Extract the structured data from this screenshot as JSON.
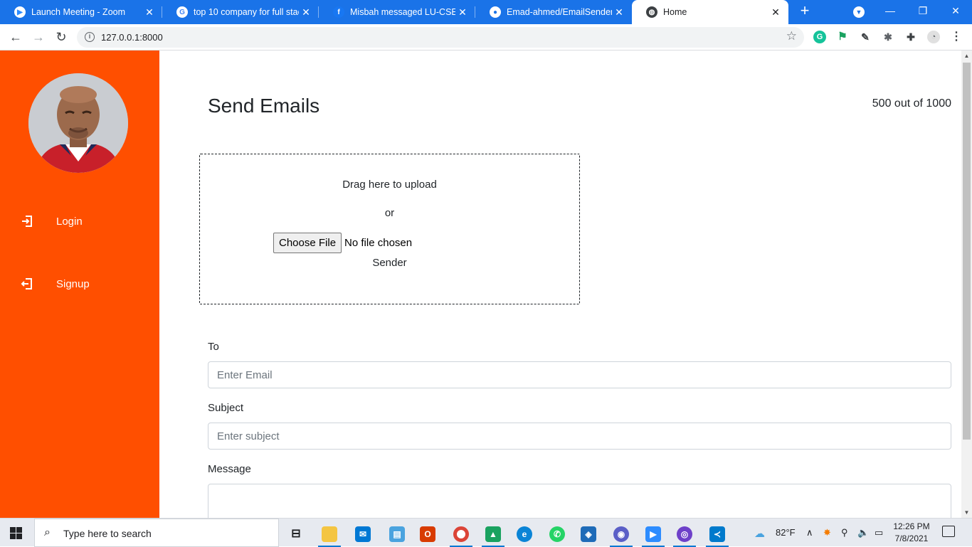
{
  "browser": {
    "tabs": [
      {
        "title": "Launch Meeting - Zoom",
        "favicon": "zoom-icon",
        "active": false
      },
      {
        "title": "top 10 company for full stack",
        "favicon": "google-icon",
        "active": false
      },
      {
        "title": "Misbah messaged LU-CSE 50",
        "favicon": "facebook-icon",
        "active": false
      },
      {
        "title": "Emad-ahmed/EmailSenderW",
        "favicon": "github-icon",
        "active": false
      },
      {
        "title": "Home",
        "favicon": "globe-icon",
        "active": true
      }
    ],
    "url": "127.0.0.1:8000"
  },
  "sidebar": {
    "accent": "#ff4f00",
    "items": [
      {
        "label": "Login",
        "icon": "login-icon"
      },
      {
        "label": "Signup",
        "icon": "login-icon"
      }
    ]
  },
  "main": {
    "title": "Send Emails",
    "count": "500 out of 1000",
    "upload": {
      "drag_text": "Drag here to upload",
      "or_text": "or",
      "choose_label": "Choose File",
      "file_status": "No file chosen",
      "sender_label": "Sender"
    },
    "to": {
      "label": "To",
      "placeholder": "Enter Email"
    },
    "subject": {
      "label": "Subject",
      "placeholder": "Enter subject"
    },
    "message": {
      "label": "Message"
    }
  },
  "taskbar": {
    "search_placeholder": "Type here to search",
    "weather": "82°F",
    "time": "12:26 PM",
    "date": "7/8/2021"
  }
}
